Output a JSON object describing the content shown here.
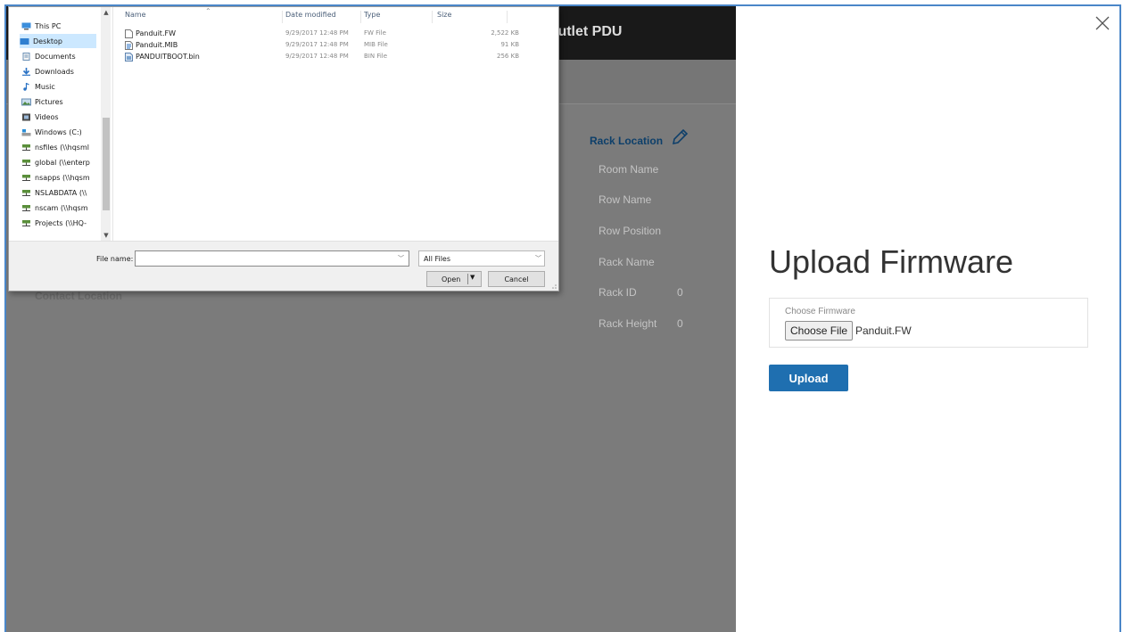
{
  "background_page": {
    "header_title": "Outlet PDU",
    "left_section_label": "Contact Location",
    "rack": {
      "title": "Rack Location",
      "edit_icon": "pencil-icon",
      "fields": [
        {
          "label": "Room Name",
          "value": ""
        },
        {
          "label": "Row Name",
          "value": ""
        },
        {
          "label": "Row Position",
          "value": ""
        },
        {
          "label": "Rack Name",
          "value": ""
        },
        {
          "label": "Rack ID",
          "value": "0"
        },
        {
          "label": "Rack Height",
          "value": "0"
        }
      ]
    }
  },
  "file_dialog": {
    "nav_items": [
      {
        "label": "This PC",
        "icon": "computer-icon",
        "selected": false
      },
      {
        "label": "Desktop",
        "icon": "desktop-icon",
        "selected": true
      },
      {
        "label": "Documents",
        "icon": "documents-icon",
        "selected": false
      },
      {
        "label": "Downloads",
        "icon": "downloads-icon",
        "selected": false
      },
      {
        "label": "Music",
        "icon": "music-icon",
        "selected": false
      },
      {
        "label": "Pictures",
        "icon": "pictures-icon",
        "selected": false
      },
      {
        "label": "Videos",
        "icon": "videos-icon",
        "selected": false
      },
      {
        "label": "Windows (C:)",
        "icon": "drive-icon",
        "selected": false
      },
      {
        "label": "nsfiles (\\\\hqsml",
        "icon": "network-drive-icon",
        "selected": false
      },
      {
        "label": "global (\\\\enterp",
        "icon": "network-drive-icon",
        "selected": false
      },
      {
        "label": "nsapps (\\\\hqsm",
        "icon": "network-drive-icon",
        "selected": false
      },
      {
        "label": "NSLABDATA (\\\\",
        "icon": "network-drive-icon",
        "selected": false
      },
      {
        "label": "nscam (\\\\hqsm",
        "icon": "network-drive-icon",
        "selected": false
      },
      {
        "label": "Projects (\\\\HQ-",
        "icon": "network-drive-icon",
        "selected": false
      }
    ],
    "columns": {
      "name": "Name",
      "date": "Date modified",
      "type": "Type",
      "size": "Size"
    },
    "files": [
      {
        "name": "Panduit.FW",
        "date": "9/29/2017 12:48 PM",
        "type": "FW File",
        "size": "2,522 KB",
        "icon": "blank-file-icon"
      },
      {
        "name": "Panduit.MIB",
        "date": "9/29/2017 12:48 PM",
        "type": "MIB File",
        "size": "91 KB",
        "icon": "text-file-icon"
      },
      {
        "name": "PANDUITBOOT.bin",
        "date": "9/29/2017 12:48 PM",
        "type": "BIN File",
        "size": "256 KB",
        "icon": "bin-file-icon"
      }
    ],
    "filename_label": "File name:",
    "filename_value": "",
    "filetype_selected": "All Files",
    "open_label": "Open",
    "cancel_label": "Cancel"
  },
  "modal": {
    "title": "Upload Firmware",
    "field_label": "Choose Firmware",
    "choose_button": "Choose File",
    "chosen_file": "Panduit.FW",
    "upload_button": "Upload",
    "close_icon": "close-icon"
  },
  "colors": {
    "overlay": "#7b7b7b",
    "header": "#191919",
    "accent": "#1f6fb0",
    "rack_title": "#0d3f6a",
    "selection": "#cce8ff"
  }
}
